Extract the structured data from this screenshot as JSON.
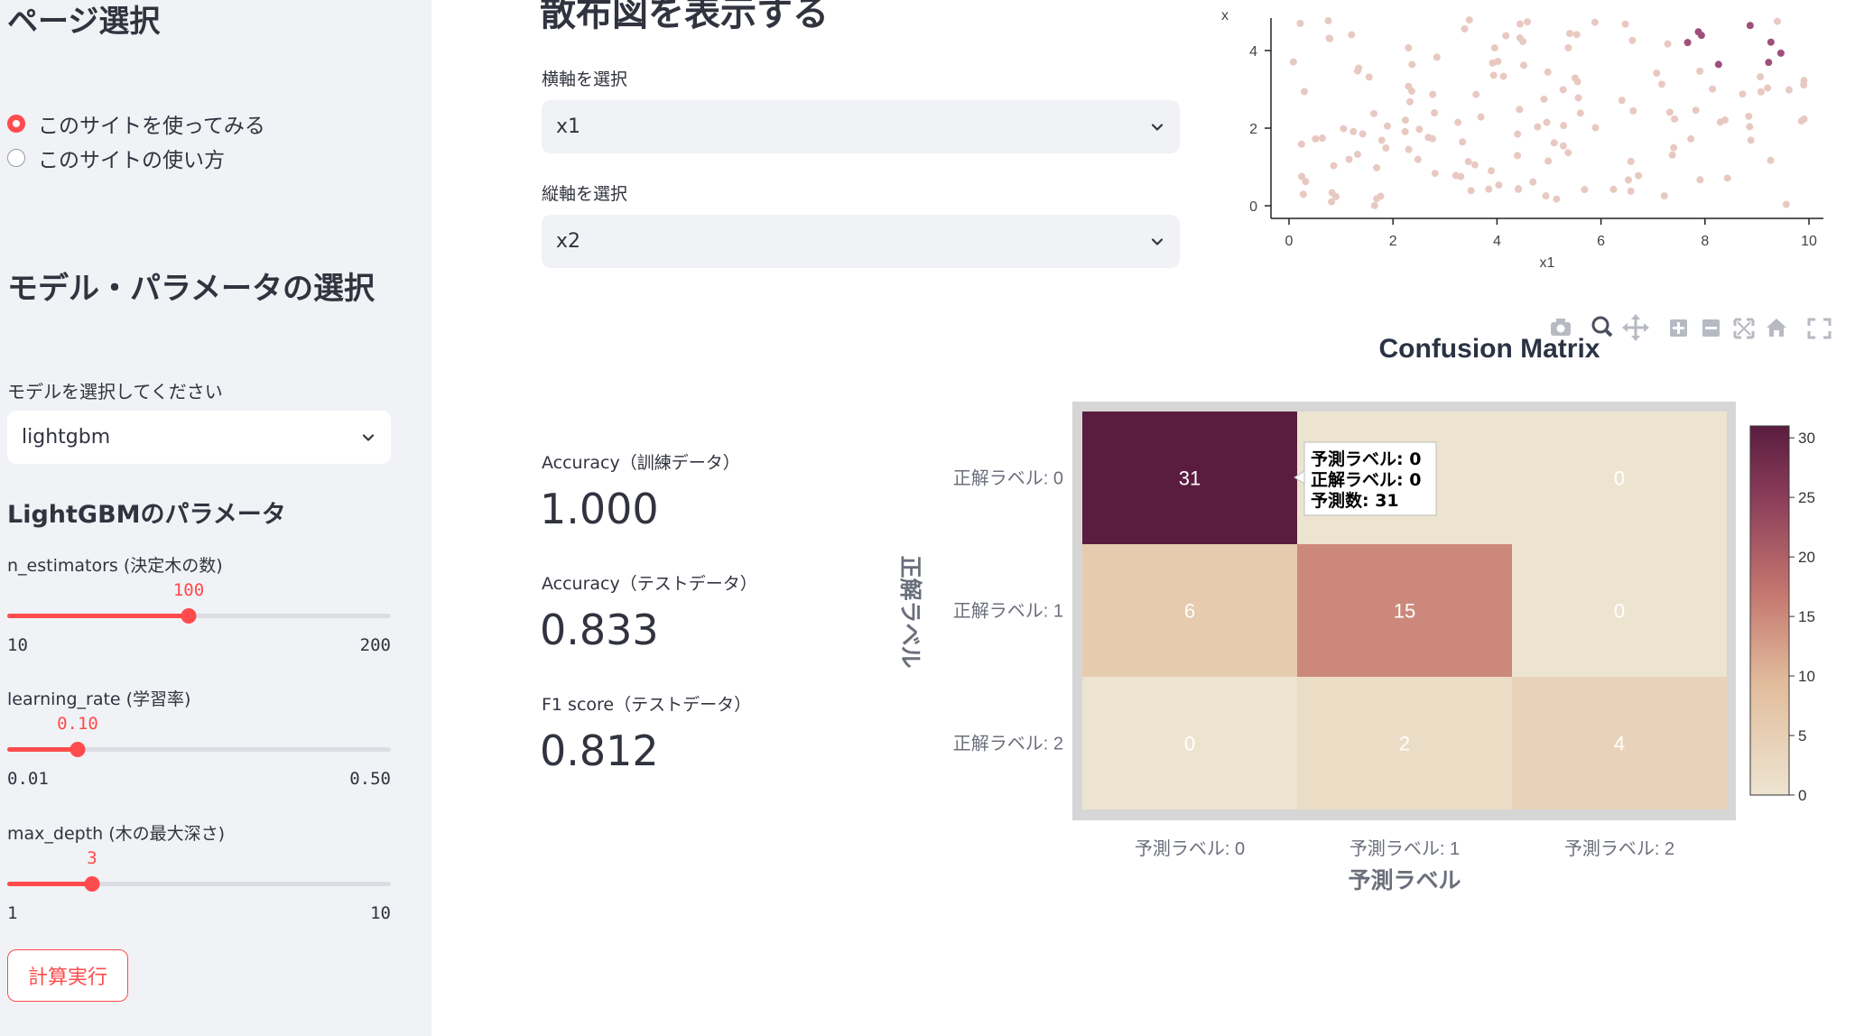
{
  "sidebar": {
    "page_select_title": "ページ選択",
    "radio_options": [
      {
        "label": "このサイトを使ってみる",
        "selected": true
      },
      {
        "label": "このサイトの使い方",
        "selected": false
      }
    ],
    "model_section_title": "モデル・パラメータの選択",
    "model_select_label": "モデルを選択してください",
    "model_select_value": "lightgbm",
    "params_title": "LightGBMのパラメータ",
    "sliders": [
      {
        "label": "n_estimators (決定木の数)",
        "value": "100",
        "min": "10",
        "max": "200",
        "fraction": 0.4737
      },
      {
        "label": "learning_rate (学習率)",
        "value": "0.10",
        "min": "0.01",
        "max": "0.50",
        "fraction": 0.1837
      },
      {
        "label": "max_depth (木の最大深さ)",
        "value": "3",
        "min": "1",
        "max": "10",
        "fraction": 0.2222
      }
    ],
    "run_button": "計算実行"
  },
  "main": {
    "scatter_section_title": "散布図を表示する",
    "x_axis_select_label": "横軸を選択",
    "x_axis_select_value": "x1",
    "y_axis_select_label": "縦軸を選択",
    "y_axis_select_value": "x2",
    "metrics": [
      {
        "label": "Accuracy（訓練データ）",
        "value": "1.000"
      },
      {
        "label": "Accuracy（テストデータ）",
        "value": "0.833"
      },
      {
        "label": "F1 score（テストデータ）",
        "value": "0.812"
      }
    ]
  },
  "scatter": {
    "xlabel": "x1",
    "x_ticks": [
      "0",
      "2",
      "4",
      "6",
      "8",
      "10"
    ],
    "y_ticks": [
      "0",
      "2",
      "4"
    ],
    "xlim": [
      0,
      10
    ],
    "point_colors": {
      "light": "#e8c9c1",
      "dark": "#9e4f7a"
    }
  },
  "confusion_matrix": {
    "title": "Confusion Matrix",
    "xlabel": "予測ラベル",
    "ylabel": "正解ラベル",
    "x_categories": [
      "予測ラベル: 0",
      "予測ラベル: 1",
      "予測ラベル: 2"
    ],
    "y_categories": [
      "正解ラベル: 0",
      "正解ラベル: 1",
      "正解ラベル: 2"
    ],
    "values": [
      [
        31,
        0,
        0
      ],
      [
        6,
        15,
        0
      ],
      [
        0,
        2,
        4
      ]
    ],
    "colorbar_ticks": [
      "0",
      "5",
      "10",
      "15",
      "20",
      "25",
      "30"
    ],
    "colorbar_range": [
      0,
      31
    ],
    "colors": {
      "low": "#ede4d0",
      "mid1": "#e2bd9d",
      "mid2": "#c4766f",
      "high": "#5a1d3f"
    },
    "tooltip": [
      "予測ラベル: 0",
      "正解ラベル: 0",
      "予測数: 31"
    ]
  },
  "chart_data": {
    "type": "heatmap",
    "title": "Confusion Matrix",
    "xlabel": "予測ラベル",
    "ylabel": "正解ラベル",
    "x": [
      "予測ラベル: 0",
      "予測ラベル: 1",
      "予測ラベル: 2"
    ],
    "y": [
      "正解ラベル: 0",
      "正解ラベル: 1",
      "正解ラベル: 2"
    ],
    "z": [
      [
        31,
        0,
        0
      ],
      [
        6,
        15,
        0
      ],
      [
        0,
        2,
        4
      ]
    ],
    "zlim": [
      0,
      31
    ]
  },
  "modebar_icons": [
    "camera-icon",
    "zoom-icon",
    "pan-icon",
    "zoom-in-icon",
    "zoom-out-icon",
    "autoscale-icon",
    "home-icon",
    "fullscreen-icon"
  ]
}
